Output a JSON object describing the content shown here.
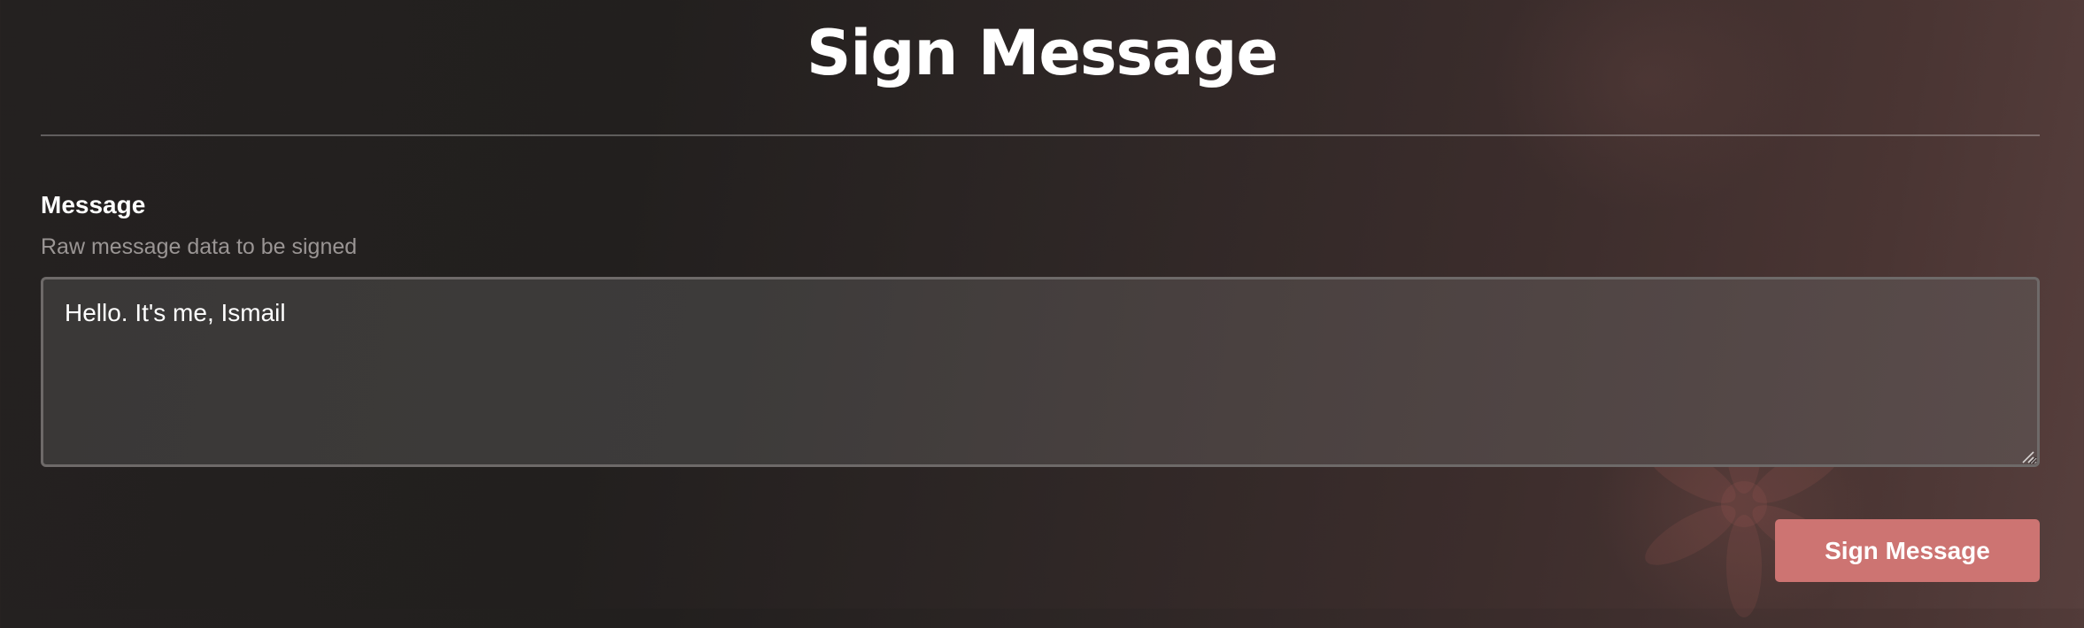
{
  "page": {
    "title": "Sign Message"
  },
  "message": {
    "label": "Message",
    "help_text": "Raw message data to be signed",
    "value": "Hello. It's me, Ismail"
  },
  "actions": {
    "sign_label": "Sign Message"
  },
  "colors": {
    "background_dark": "#221f1e",
    "background_light": "#573f3d",
    "accent": "#cd7472",
    "divider": "#6e6a69"
  },
  "icons": {
    "resize_handle": "resize-handle-icon",
    "decoration": "flower-decoration-icon"
  }
}
